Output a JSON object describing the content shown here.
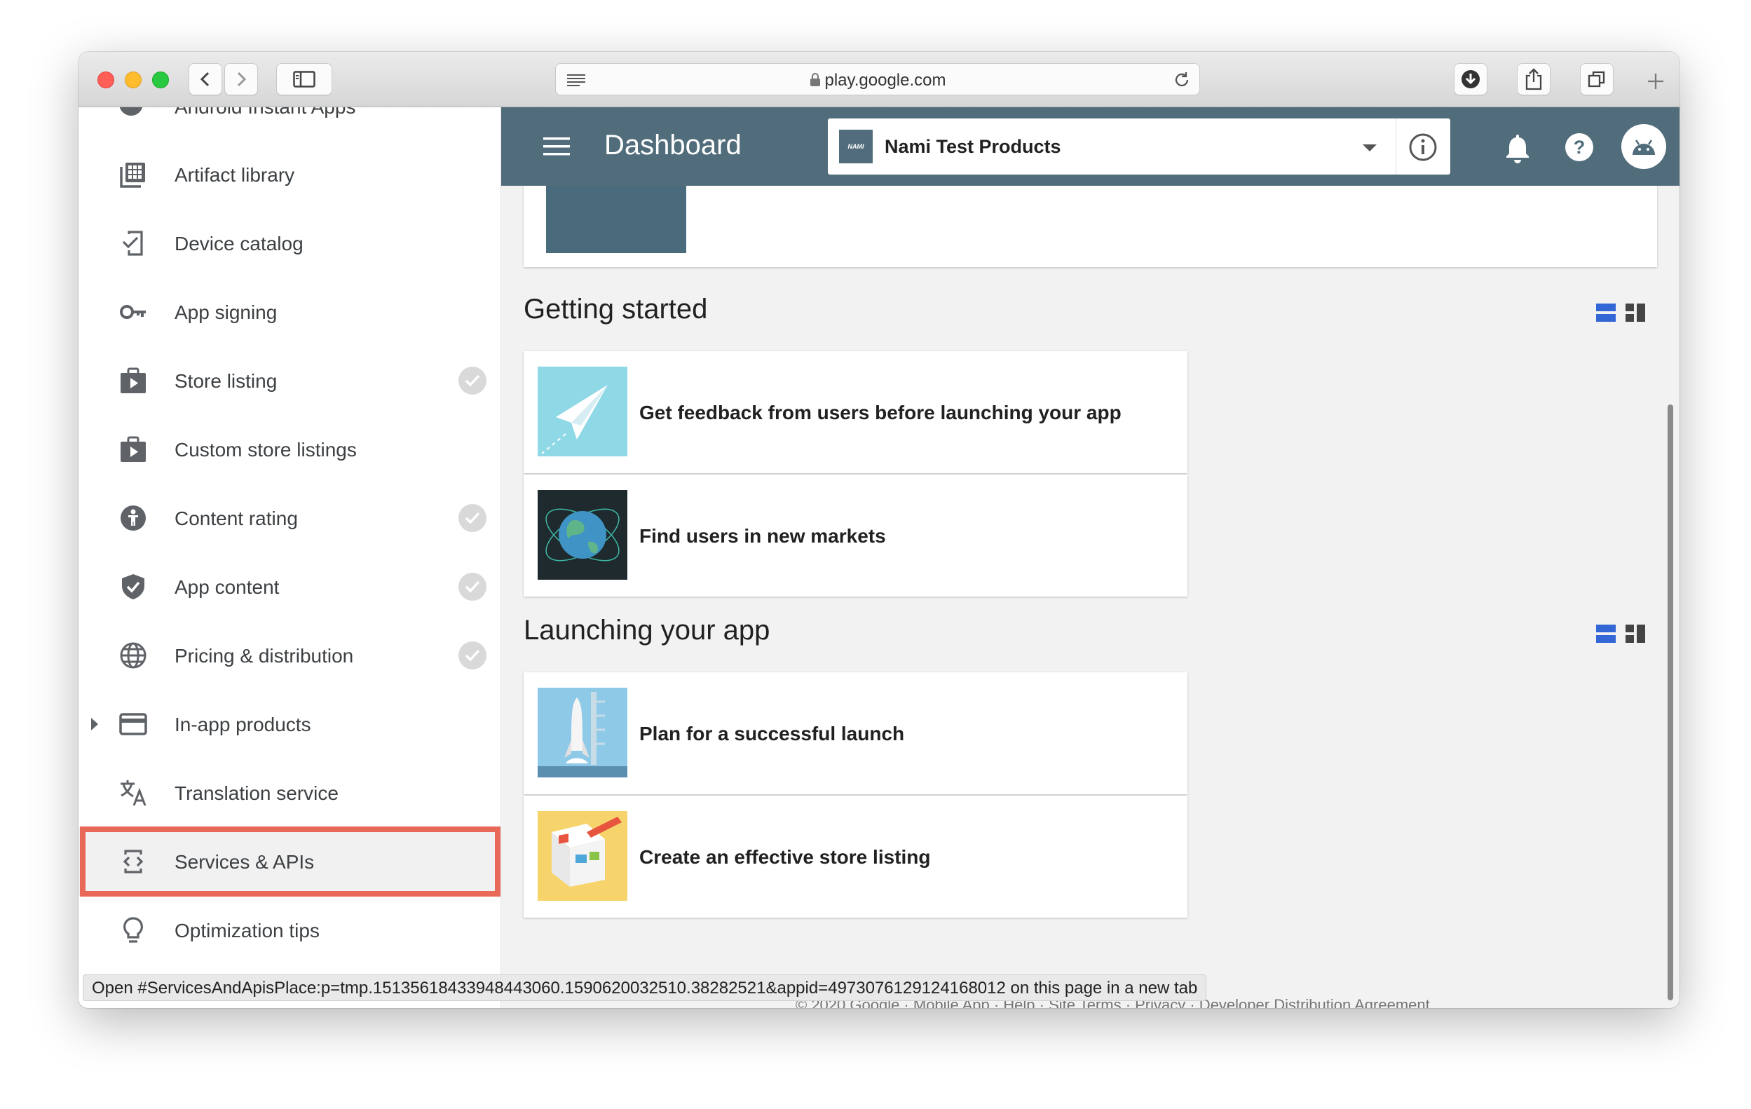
{
  "browser": {
    "url": "play.google.com",
    "status_text": "Open #ServicesAndApisPlace:p=tmp.15135618433948443060.1590620032510.38282521&appid=4973076129124168012 on this page in a new tab"
  },
  "sidebar": {
    "partial_top_label": "Android Instant Apps",
    "items": [
      {
        "label": "Artifact library",
        "icon": "library-icon",
        "checked": false
      },
      {
        "label": "Device catalog",
        "icon": "device-check-icon",
        "checked": false
      },
      {
        "label": "App signing",
        "icon": "key-icon",
        "checked": false
      },
      {
        "label": "Store listing",
        "icon": "store-bag-icon",
        "checked": true
      },
      {
        "label": "Custom store listings",
        "icon": "store-bag-icon",
        "checked": false
      },
      {
        "label": "Content rating",
        "icon": "content-rating-icon",
        "checked": true
      },
      {
        "label": "App content",
        "icon": "shield-check-icon",
        "checked": true
      },
      {
        "label": "Pricing & distribution",
        "icon": "globe-icon",
        "checked": true
      },
      {
        "label": "In-app products",
        "icon": "credit-card-icon",
        "checked": false,
        "expandable": true
      },
      {
        "label": "Translation service",
        "icon": "translate-icon",
        "checked": false
      },
      {
        "label": "Services & APIs",
        "icon": "services-apis-icon",
        "checked": false,
        "highlighted": true
      },
      {
        "label": "Optimization tips",
        "icon": "lightbulb-icon",
        "checked": false
      }
    ]
  },
  "header": {
    "title": "Dashboard",
    "app_name": "Nami Test Products",
    "app_logo_text": "NAMI"
  },
  "sections": [
    {
      "title": "Getting started",
      "tiles": [
        {
          "text": "Get feedback from users before launching your app"
        },
        {
          "text": "Find users in new markets"
        }
      ]
    },
    {
      "title": "Launching your app",
      "tiles": [
        {
          "text": "Plan for a successful launch"
        },
        {
          "text": "Create an effective store listing"
        }
      ]
    }
  ],
  "footer_partial": "© 2020 Google · Mobile App · Help · Site Terms · Privacy · Developer Distribution Agreement",
  "colors": {
    "header_bg": "#516d7b",
    "highlight": "#e8685a",
    "view_toggle_active": "#3367d6"
  }
}
